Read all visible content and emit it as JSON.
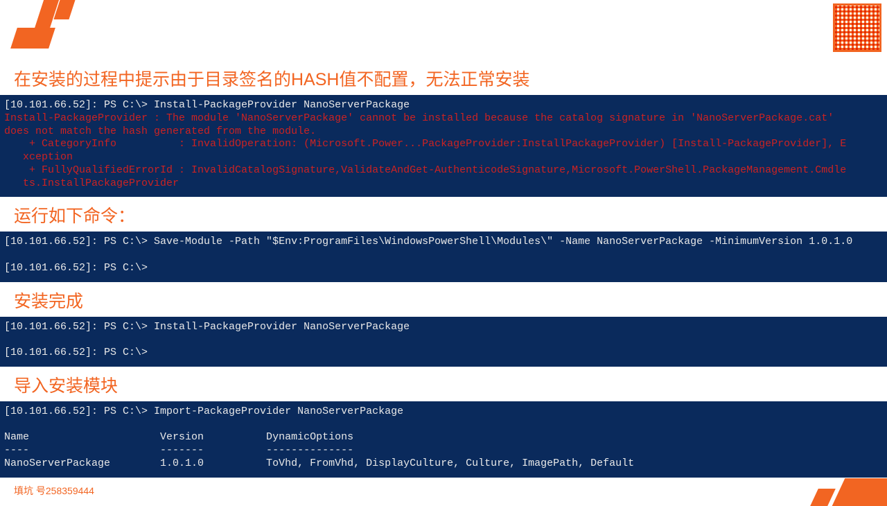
{
  "headings": {
    "h1": "在安装的过程中提示由于目录签名的HASH值不配置，无法正常安装",
    "h2": "运行如下命令：",
    "h3": "安装完成",
    "h4": "导入安装模块"
  },
  "term1": {
    "cmd": "[10.101.66.52]: PS C:\\> Install-PackageProvider NanoServerPackage",
    "err1": "Install-PackageProvider : The module 'NanoServerPackage' cannot be installed because the catalog signature in 'NanoServerPackage.cat'",
    "err2": "does not match the hash generated from the module.",
    "err3": "    + CategoryInfo          : InvalidOperation: (Microsoft.Power...PackageProvider:InstallPackageProvider) [Install-PackageProvider], E",
    "err4": "   xception",
    "err5": "    + FullyQualifiedErrorId : InvalidCatalogSignature,ValidateAndGet-AuthenticodeSignature,Microsoft.PowerShell.PackageManagement.Cmdle",
    "err6": "   ts.InstallPackageProvider"
  },
  "term2": {
    "l1": "[10.101.66.52]: PS C:\\> Save-Module -Path \"$Env:ProgramFiles\\WindowsPowerShell\\Modules\\\" -Name NanoServerPackage -MinimumVersion 1.0.1.0",
    "l2": "",
    "l3": "[10.101.66.52]: PS C:\\>"
  },
  "term3": {
    "l1": "[10.101.66.52]: PS C:\\> Install-PackageProvider NanoServerPackage",
    "l2": "",
    "l3": "[10.101.66.52]: PS C:\\>"
  },
  "term4": {
    "l1": "[10.101.66.52]: PS C:\\> Import-PackageProvider NanoServerPackage",
    "l2": "",
    "l3": "Name                     Version          DynamicOptions",
    "l4": "----                     -------          --------------",
    "l5": "NanoServerPackage        1.0.1.0          ToVhd, FromVhd, DisplayCulture, Culture, ImagePath, Default"
  },
  "footer": "填坑 号258359444"
}
